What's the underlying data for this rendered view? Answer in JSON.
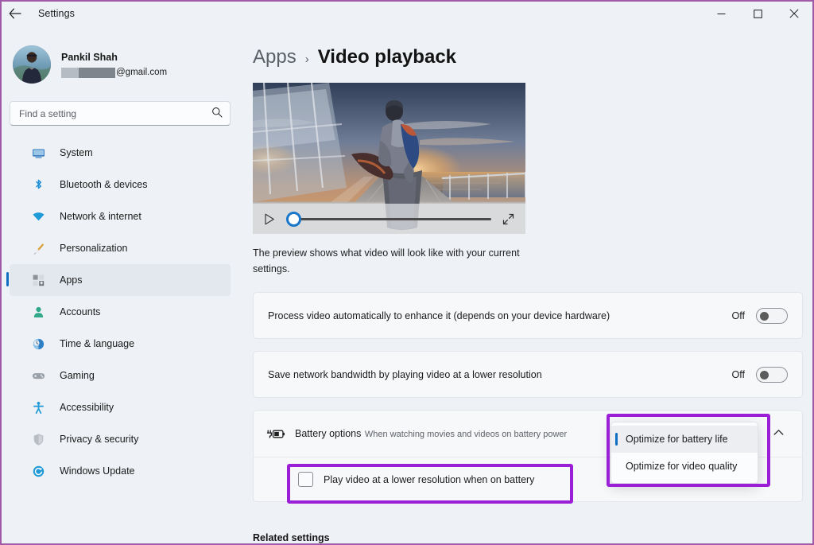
{
  "window": {
    "title": "Settings",
    "back_icon": "back-arrow-icon",
    "minimize_label": "–",
    "maximize_label": "☐",
    "close_label": "✕",
    "border_color": "#a05ba8"
  },
  "account": {
    "name": "Pankil Shah",
    "email_tail": "@gmail.com",
    "avatar_alt": "user-avatar"
  },
  "search": {
    "placeholder": "Find a setting",
    "value": "",
    "icon": "search-icon"
  },
  "sidebar": {
    "items": [
      {
        "label": "System",
        "icon": "monitor-icon",
        "active": false
      },
      {
        "label": "Bluetooth & devices",
        "icon": "bluetooth-icon",
        "active": false
      },
      {
        "label": "Network & internet",
        "icon": "wifi-icon",
        "active": false
      },
      {
        "label": "Personalization",
        "icon": "paintbrush-icon",
        "active": false
      },
      {
        "label": "Apps",
        "icon": "apps-grid-icon",
        "active": true
      },
      {
        "label": "Accounts",
        "icon": "person-icon",
        "active": false
      },
      {
        "label": "Time & language",
        "icon": "clock-globe-icon",
        "active": false
      },
      {
        "label": "Gaming",
        "icon": "gamepad-icon",
        "active": false
      },
      {
        "label": "Accessibility",
        "icon": "accessibility-icon",
        "active": false
      },
      {
        "label": "Privacy & security",
        "icon": "shield-icon",
        "active": false
      },
      {
        "label": "Windows Update",
        "icon": "refresh-circle-icon",
        "active": false
      }
    ]
  },
  "breadcrumb": {
    "parent": "Apps",
    "separator": "›",
    "current": "Video playback"
  },
  "preview": {
    "help_text": "The preview shows what video will look like with your current settings.",
    "play_icon": "play-icon",
    "expand_icon": "fullscreen-expand-icon",
    "seek_position_percent": 0
  },
  "settings": {
    "process_video": {
      "label": "Process video automatically to enhance it (depends on your device hardware)",
      "state": "Off",
      "enabled": false
    },
    "save_bandwidth": {
      "label": "Save network bandwidth by playing video at a lower resolution",
      "state": "Off",
      "enabled": false
    },
    "battery": {
      "icon": "battery-charging-icon",
      "title": "Battery options",
      "subtitle": "When watching movies and videos on battery power",
      "chevron_icon": "chevron-up-icon",
      "expanded": true,
      "checkbox": {
        "label": "Play video at a lower resolution when on battery",
        "checked": false
      },
      "dropdown": {
        "open": true,
        "selected": "Optimize for battery life",
        "options": [
          "Optimize for battery life",
          "Optimize for video quality"
        ]
      }
    }
  },
  "related_settings_heading": "Related settings",
  "annotations": {
    "color": "#9b1fd6",
    "highlights": [
      "battery-options-dropdown",
      "lower-resolution-checkbox"
    ]
  }
}
